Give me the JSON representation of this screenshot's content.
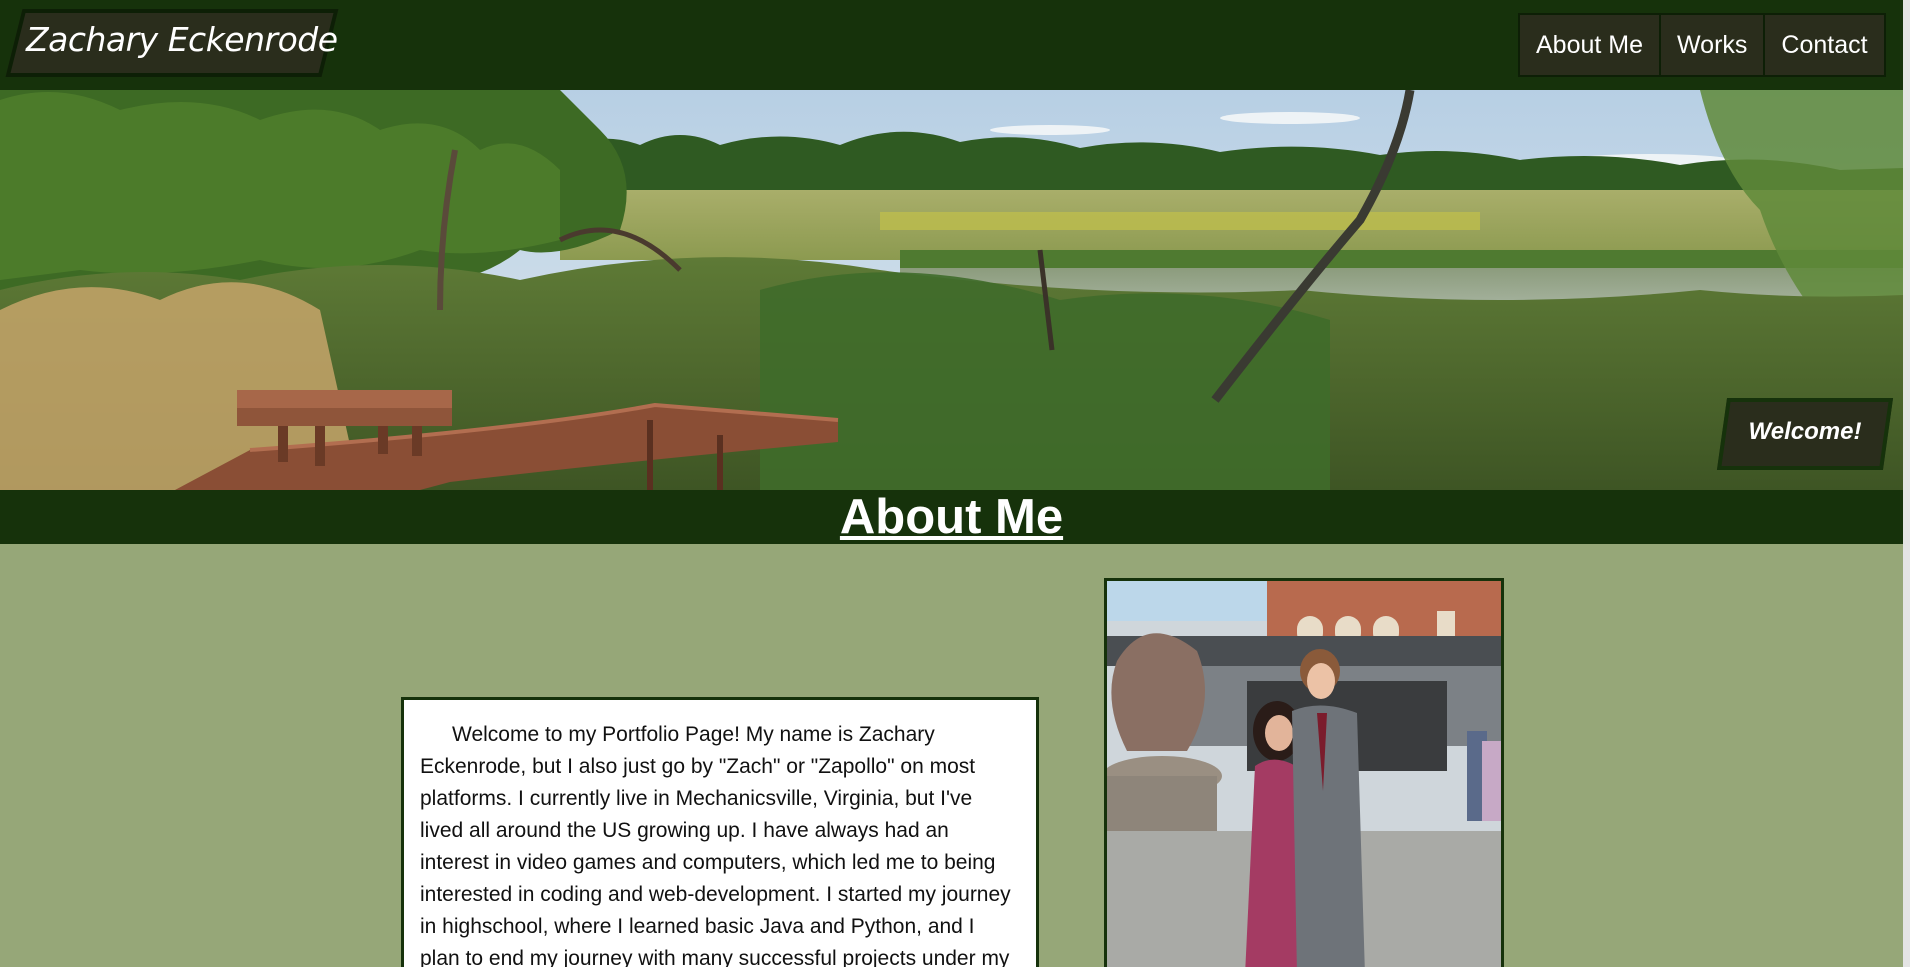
{
  "header": {
    "site_name": "Zachary Eckenrode",
    "nav": [
      {
        "label": "About Me"
      },
      {
        "label": "Works"
      },
      {
        "label": "Contact"
      }
    ]
  },
  "banner": {
    "badge": "Welcome!"
  },
  "section": {
    "title": "About Me"
  },
  "about": {
    "intro": "Welcome to my Portfolio Page! My name is Zachary Eckenrode, but I also just go by \"Zach\" or \"Zapollo\" on most platforms. I currently live in Mechanicsville, Virginia, but I've lived all around the US growing up. I have always had an interest in video games and computers, which led me to being interested in coding and web-development. I started my journey in highschool, where I learned basic Java and Python, and I plan to end my journey with many successful projects under my belt."
  },
  "colors": {
    "header_bg": "#16320b",
    "button_bg": "#2a2d1c",
    "page_bg": "#96a778"
  }
}
